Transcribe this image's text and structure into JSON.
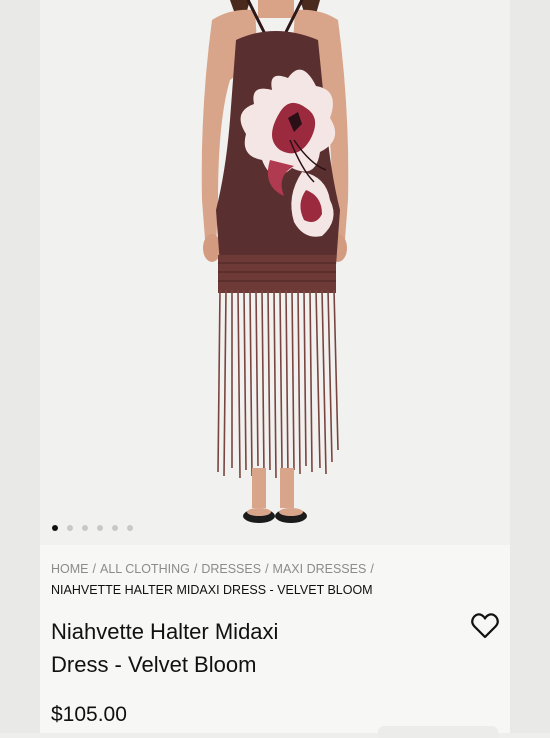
{
  "carousel": {
    "total_slides": 6,
    "active_index": 0
  },
  "breadcrumb": {
    "items": [
      "HOME",
      "ALL CLOTHING",
      "DRESSES",
      "MAXI DRESSES"
    ],
    "separator": "/",
    "current": "NIAHVETTE HALTER MIDAXI DRESS - VELVET BLOOM"
  },
  "product": {
    "title_line1": "Niahvette Halter Midaxi",
    "title_line2": "Dress - Velvet Bloom",
    "price": "$105.00"
  },
  "icons": {
    "wishlist": "heart-outline-icon"
  },
  "colors": {
    "dress": "#5a2f30",
    "fringe": "#7a4540",
    "flower_petal": "#f3e6e4",
    "flower_accent": "#9c2a3e",
    "skin": "#d9a58a",
    "text": "#111111",
    "muted_text": "#8b8b8b"
  }
}
